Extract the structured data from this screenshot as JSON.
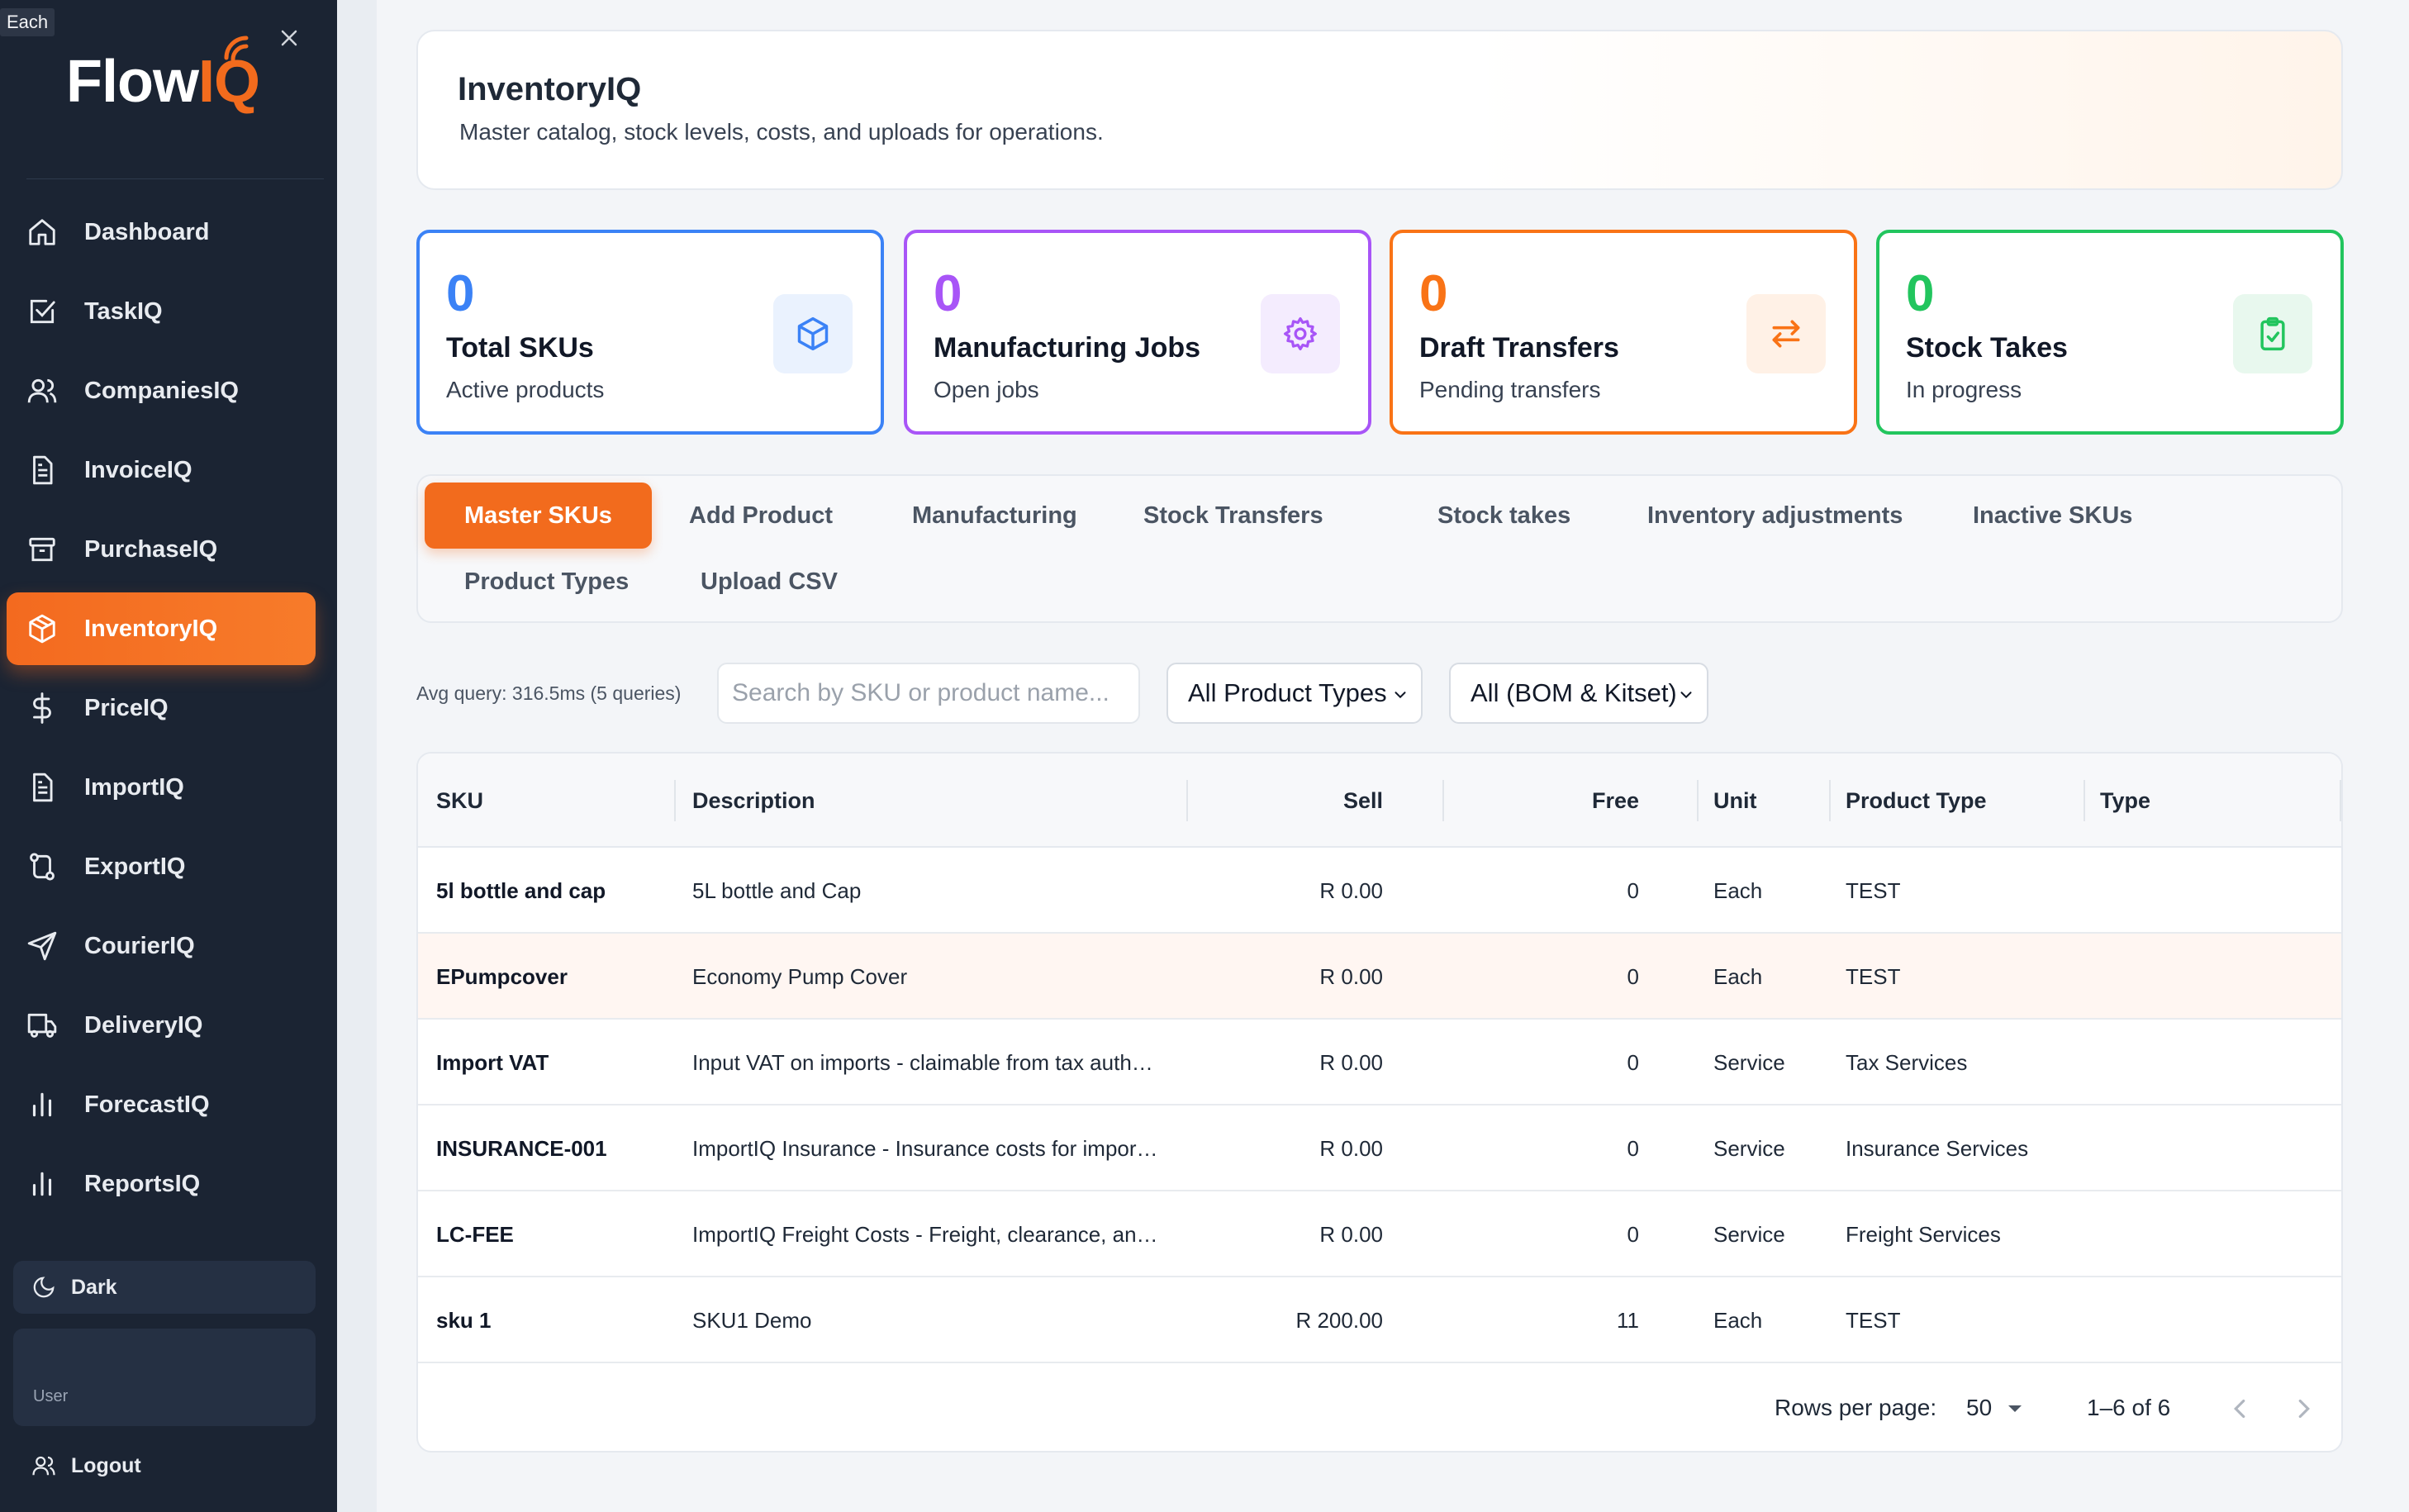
{
  "tooltip": "Each",
  "brand": {
    "name_main": "Flow",
    "name_accent": "IQ"
  },
  "sidebar": {
    "items": [
      {
        "label": "Dashboard",
        "icon": "home-icon"
      },
      {
        "label": "TaskIQ",
        "icon": "checkbox-icon"
      },
      {
        "label": "CompaniesIQ",
        "icon": "users-icon"
      },
      {
        "label": "InvoiceIQ",
        "icon": "document-icon"
      },
      {
        "label": "PurchaseIQ",
        "icon": "archive-icon"
      },
      {
        "label": "InventoryIQ",
        "icon": "box-icon",
        "active": true
      },
      {
        "label": "PriceIQ",
        "icon": "dollar-icon"
      },
      {
        "label": "ImportIQ",
        "icon": "document-icon"
      },
      {
        "label": "ExportIQ",
        "icon": "route-icon"
      },
      {
        "label": "CourierIQ",
        "icon": "send-icon"
      },
      {
        "label": "DeliveryIQ",
        "icon": "truck-icon"
      },
      {
        "label": "ForecastIQ",
        "icon": "bar-chart-icon"
      },
      {
        "label": "ReportsIQ",
        "icon": "bar-chart-icon"
      }
    ],
    "dark_label": "Dark",
    "user_label": "User",
    "logout_label": "Logout"
  },
  "header": {
    "title": "InventoryIQ",
    "subtitle": "Master catalog, stock levels, costs, and uploads for operations."
  },
  "stats": [
    {
      "value": "0",
      "title": "Total SKUs",
      "sub": "Active products",
      "icon": "cube-icon",
      "color": "#3b82f6"
    },
    {
      "value": "0",
      "title": "Manufacturing Jobs",
      "sub": "Open jobs",
      "icon": "gear-icon",
      "color": "#a855f7"
    },
    {
      "value": "0",
      "title": "Draft Transfers",
      "sub": "Pending transfers",
      "icon": "transfer-icon",
      "color": "#f97316"
    },
    {
      "value": "0",
      "title": "Stock Takes",
      "sub": "In progress",
      "icon": "clipboard-check-icon",
      "color": "#22c55e"
    }
  ],
  "tabs": [
    {
      "label": "Master SKUs",
      "active": true
    },
    {
      "label": "Add Product"
    },
    {
      "label": "Manufacturing"
    },
    {
      "label": "Stock Transfers"
    },
    {
      "label": "Stock takes"
    },
    {
      "label": "Inventory adjustments"
    },
    {
      "label": "Inactive SKUs"
    },
    {
      "label": "Product Types"
    },
    {
      "label": "Upload CSV"
    }
  ],
  "filters": {
    "query_stats": "Avg query: 316.5ms (5 queries)",
    "search_placeholder": "Search by SKU or product name...",
    "product_types_value": "All Product Types",
    "bom_value": "All (BOM & Kitset)"
  },
  "table": {
    "columns": [
      "SKU",
      "Description",
      "Sell",
      "Free",
      "Unit",
      "Product Type",
      "Type"
    ],
    "rows": [
      {
        "sku": "5l bottle and cap",
        "description": "5L bottle and Cap",
        "sell": "R 0.00",
        "free": "0",
        "unit": "Each",
        "product_type": "TEST",
        "type": ""
      },
      {
        "sku": "EPumpcover",
        "description": "Economy Pump Cover",
        "sell": "R 0.00",
        "free": "0",
        "unit": "Each",
        "product_type": "TEST",
        "type": ""
      },
      {
        "sku": "Import VAT",
        "description": "Input VAT on imports - claimable from tax auth…",
        "sell": "R 0.00",
        "free": "0",
        "unit": "Service",
        "product_type": "Tax Services",
        "type": ""
      },
      {
        "sku": "INSURANCE-001",
        "description": "ImportIQ Insurance - Insurance costs for impor…",
        "sell": "R 0.00",
        "free": "0",
        "unit": "Service",
        "product_type": "Insurance Services",
        "type": ""
      },
      {
        "sku": "LC-FEE",
        "description": "ImportIQ Freight Costs - Freight, clearance, an…",
        "sell": "R 0.00",
        "free": "0",
        "unit": "Service",
        "product_type": "Freight Services",
        "type": ""
      },
      {
        "sku": "sku 1",
        "description": "SKU1 Demo",
        "sell": "R 200.00",
        "free": "11",
        "unit": "Each",
        "product_type": "TEST",
        "type": ""
      }
    ]
  },
  "pagination": {
    "rows_per_page_label": "Rows per page:",
    "rows_per_page_value": "50",
    "range": "1–6 of 6"
  }
}
